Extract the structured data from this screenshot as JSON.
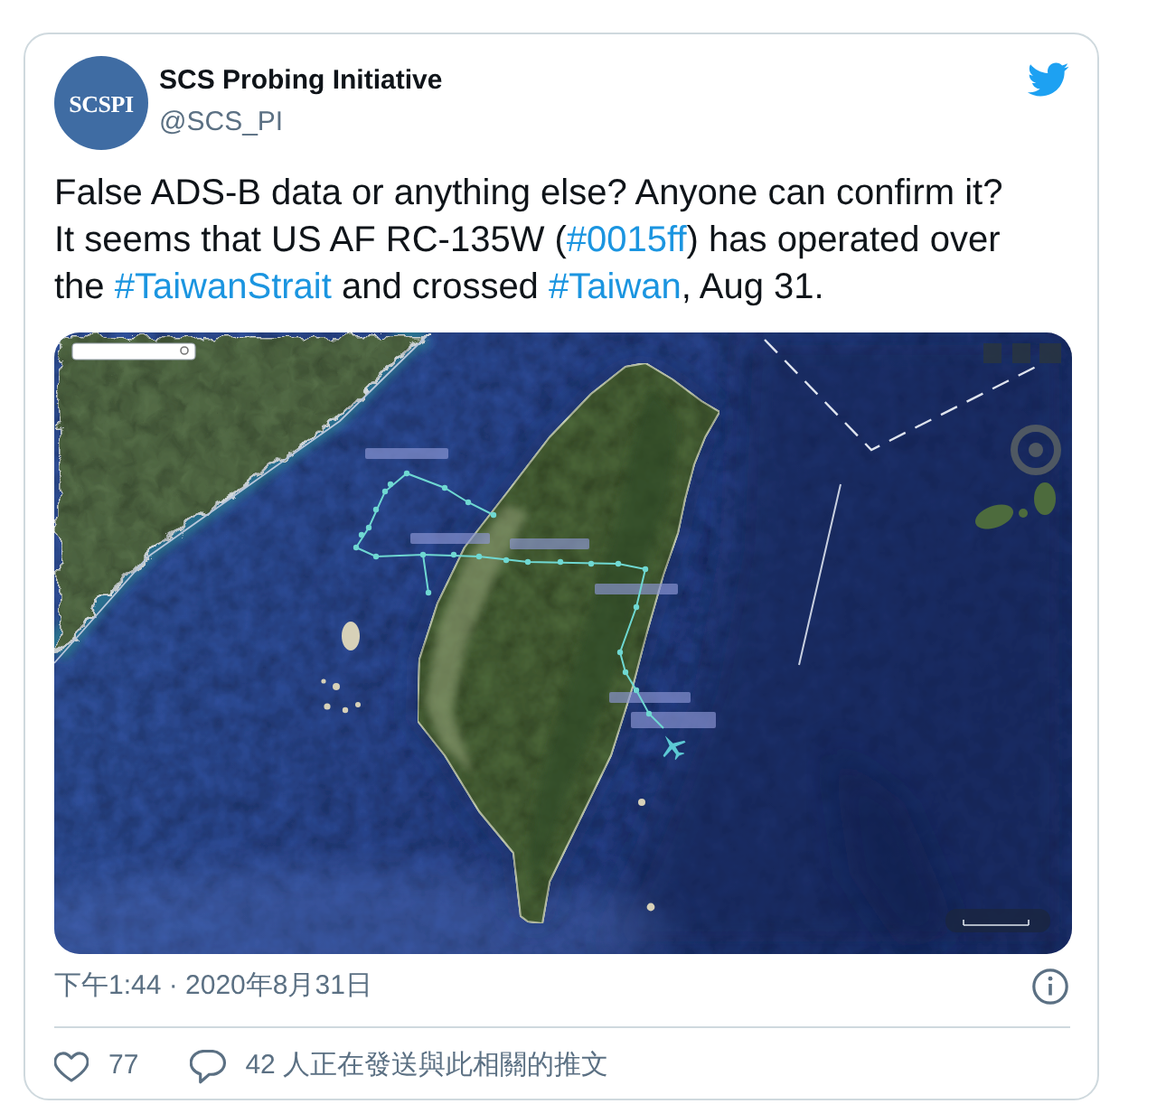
{
  "tweet": {
    "author": {
      "avatar_text": "SCSPI",
      "name": "SCS Probing Initiative",
      "handle": "@SCS_PI"
    },
    "text": [
      {
        "kind": "plain",
        "text": "False ADS-B data or anything else? Anyone can confirm it?\nIt seems that US AF RC-135W ("
      },
      {
        "kind": "hashtag",
        "text": "#0015ff"
      },
      {
        "kind": "plain",
        "text": ") has operated over the "
      },
      {
        "kind": "hashtag",
        "text": "#TaiwanStrait"
      },
      {
        "kind": "plain",
        "text": " and crossed "
      },
      {
        "kind": "hashtag",
        "text": "#Taiwan"
      },
      {
        "kind": "plain",
        "text": ", Aug 31."
      }
    ],
    "timestamp": "下午1:44 · 2020年8月31日",
    "actions": [
      {
        "kind": "like",
        "text": "77"
      },
      {
        "kind": "conversation",
        "text": "42 人正在發送與此相關的推文"
      }
    ]
  }
}
